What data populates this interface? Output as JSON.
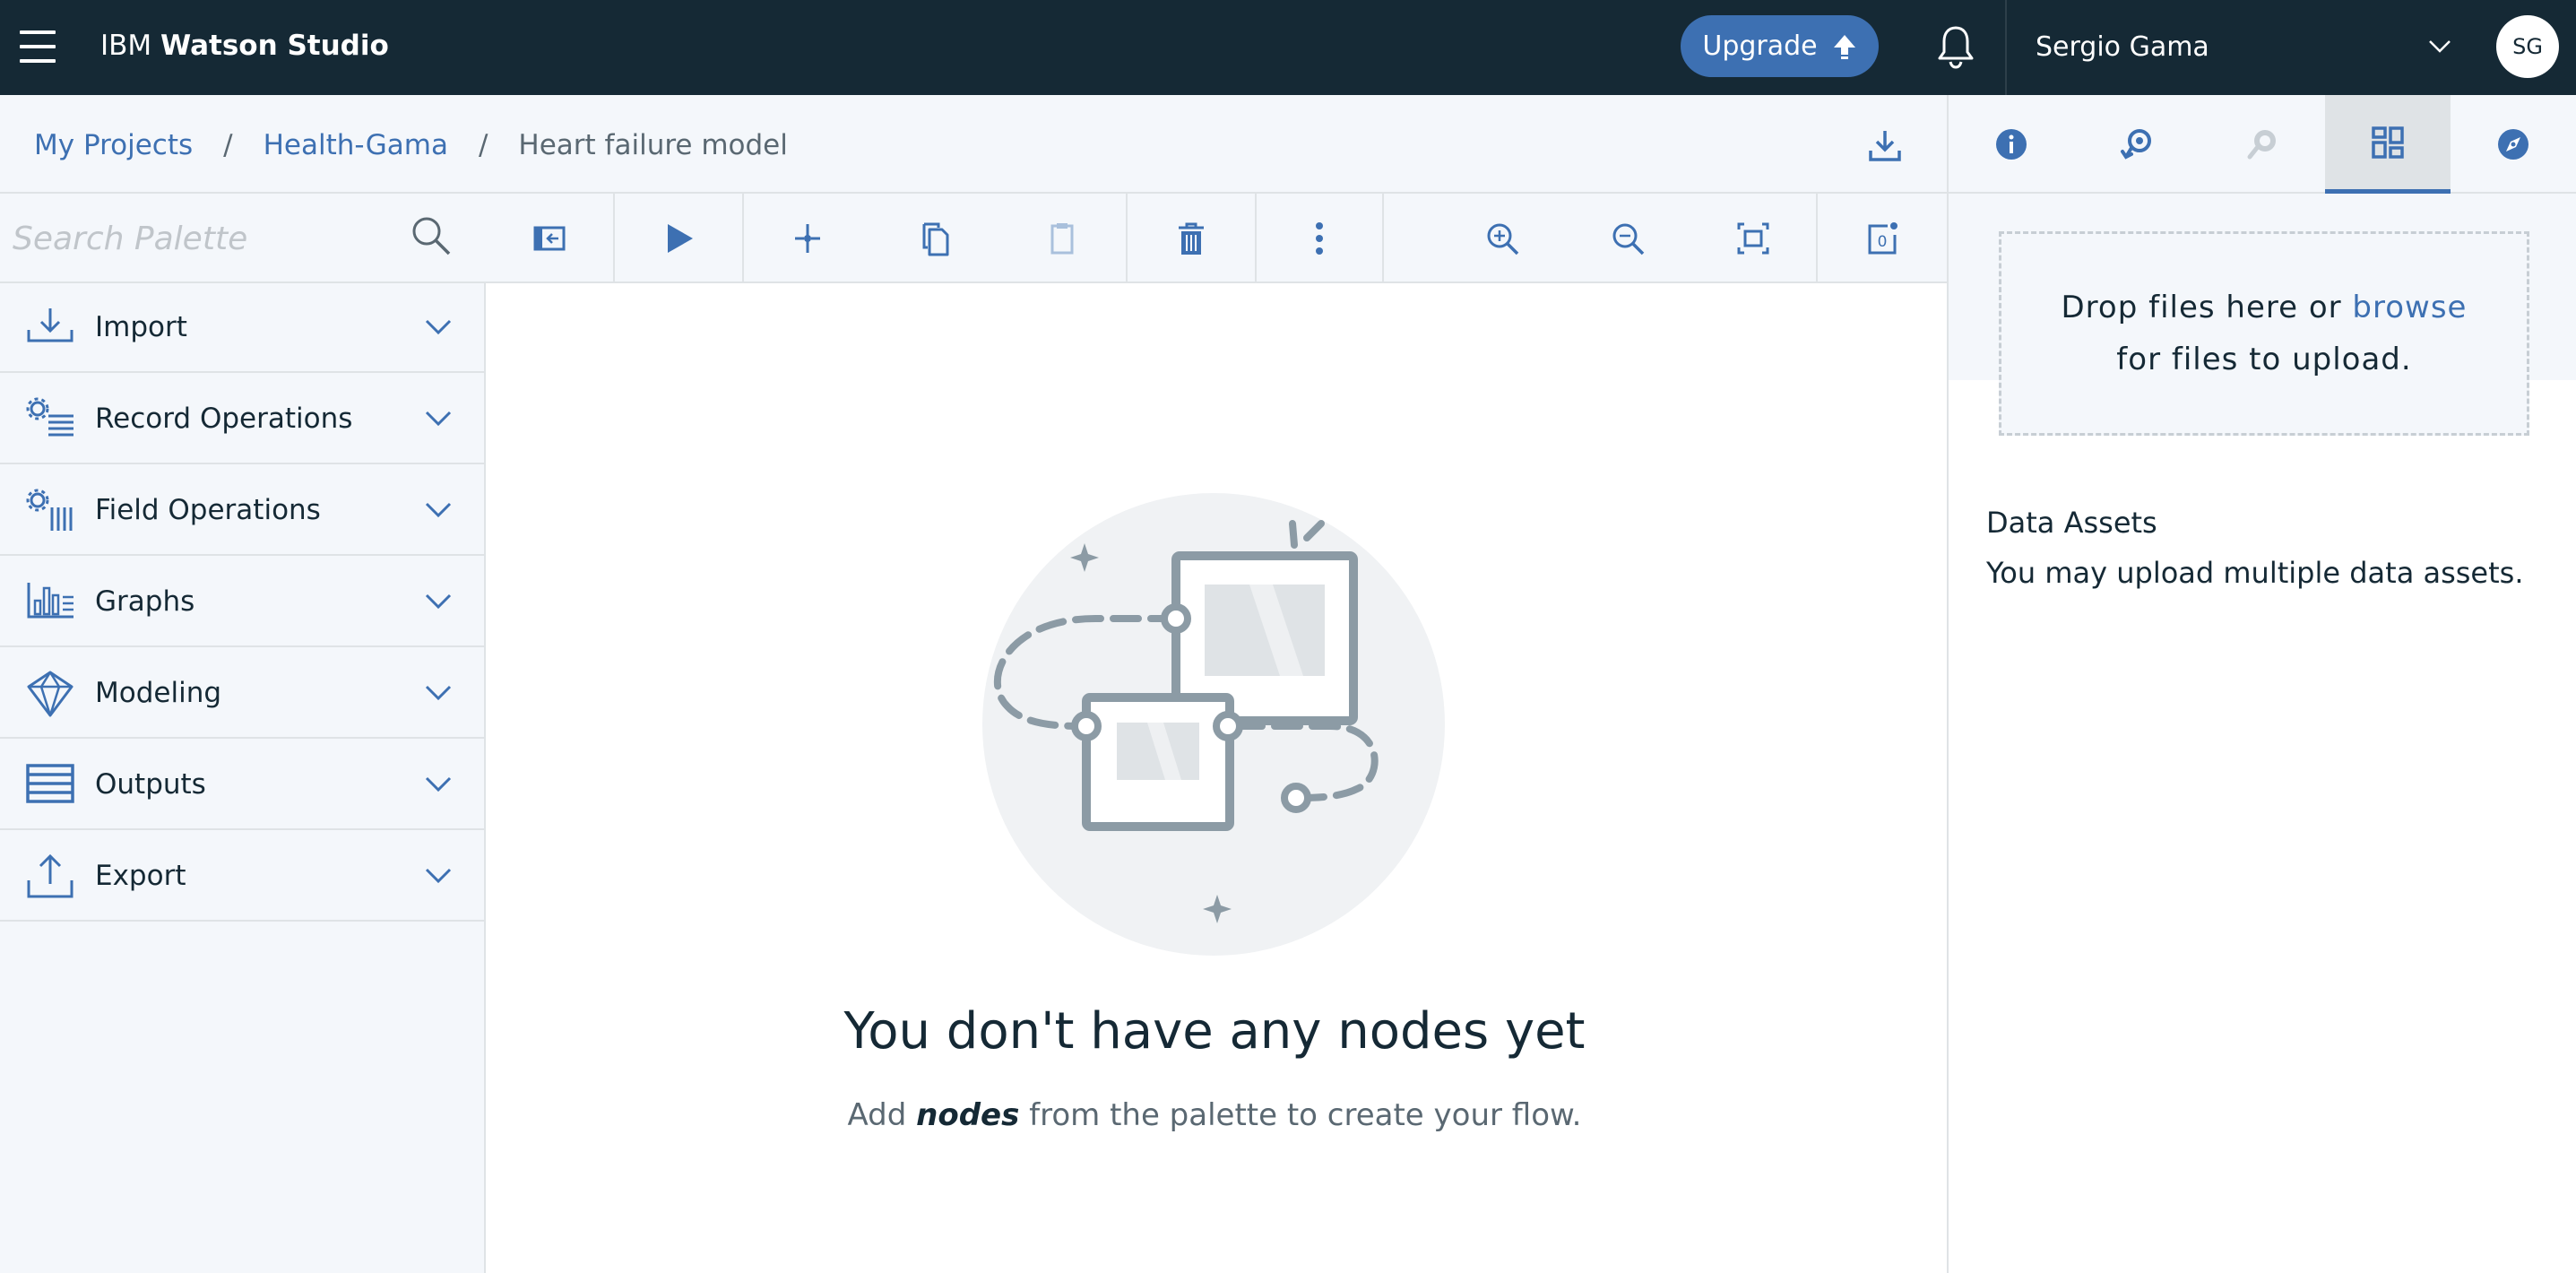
{
  "topbar": {
    "brand_prefix": "IBM",
    "brand_name": "Watson Studio",
    "upgrade_label": "Upgrade",
    "user_name": "Sergio Gama",
    "avatar_initials": "SG"
  },
  "breadcrumb": {
    "items": [
      "My Projects",
      "Health-Gama"
    ],
    "separator": "/",
    "current": "Heart failure model"
  },
  "palette": {
    "search_placeholder": "Search Palette",
    "items": [
      {
        "label": "Import",
        "icon": "import-icon"
      },
      {
        "label": "Record Operations",
        "icon": "record-operations-icon"
      },
      {
        "label": "Field Operations",
        "icon": "field-operations-icon"
      },
      {
        "label": "Graphs",
        "icon": "graphs-icon"
      },
      {
        "label": "Modeling",
        "icon": "modeling-icon"
      },
      {
        "label": "Outputs",
        "icon": "outputs-icon"
      },
      {
        "label": "Export",
        "icon": "export-icon"
      }
    ]
  },
  "toolbar": {
    "icons": [
      "toggle-palette-icon",
      "run-icon",
      "cut-icon",
      "copy-icon",
      "paste-icon",
      "delete-icon",
      "overflow-menu-icon",
      "zoom-in-icon",
      "zoom-out-icon",
      "fit-to-screen-icon",
      "comments-icon"
    ],
    "comment_count": "0"
  },
  "canvas": {
    "empty_title": "You don't have any nodes yet",
    "empty_sub_prefix": "Add ",
    "empty_sub_emphasis": "nodes",
    "empty_sub_suffix": " from the palette to create your flow."
  },
  "right_panel": {
    "tabs": [
      "info-icon",
      "history-icon",
      "chat-icon",
      "data-assets-icon",
      "explore-icon"
    ],
    "active_tab": "data-assets-icon",
    "drop_text_prefix": "Drop files here or ",
    "drop_browse": "browse",
    "drop_text_line2": "for files to upload.",
    "assets_title": "Data Assets",
    "assets_desc": "You may upload multiple data assets."
  },
  "colors": {
    "topbar_bg": "#152935",
    "accent": "#3d70b2",
    "panel_bg": "#f4f7fb",
    "border": "#dfe3e6",
    "text": "#152935",
    "muted_text": "#5a6872"
  }
}
